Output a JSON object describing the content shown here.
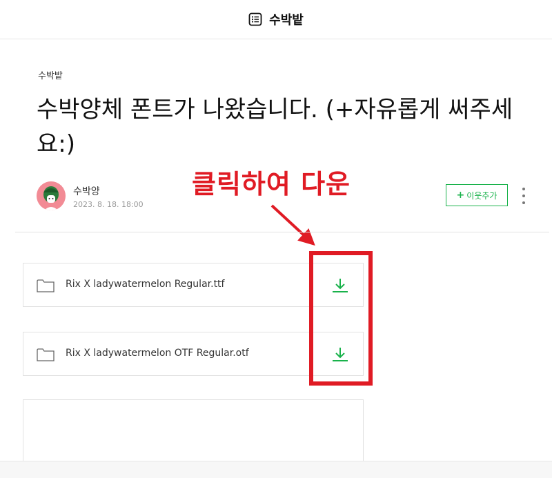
{
  "header": {
    "blog_title": "수박밭"
  },
  "post": {
    "category": "수박밭",
    "title_line1": "수박양체 폰트가 나왔습니다. (+자유롭게 써주세",
    "title_line2": "요:)",
    "author": "수박양",
    "date": "2023. 8. 18. 18:00",
    "follow_plus": "+",
    "follow_label": "이웃추가"
  },
  "annotation": {
    "text": "클릭하여 다운",
    "color": "#e01b24"
  },
  "files": [
    {
      "name": "Rix X ladywatermelon Regular.ttf"
    },
    {
      "name": "Rix X ladywatermelon OTF Regular.otf"
    }
  ],
  "colors": {
    "accent_green": "#19b24b",
    "highlight_red": "#e01b24"
  },
  "icons": {
    "header": "list-icon",
    "file": "folder-icon",
    "download": "download-arrow-icon",
    "more": "more-vertical-icon"
  }
}
